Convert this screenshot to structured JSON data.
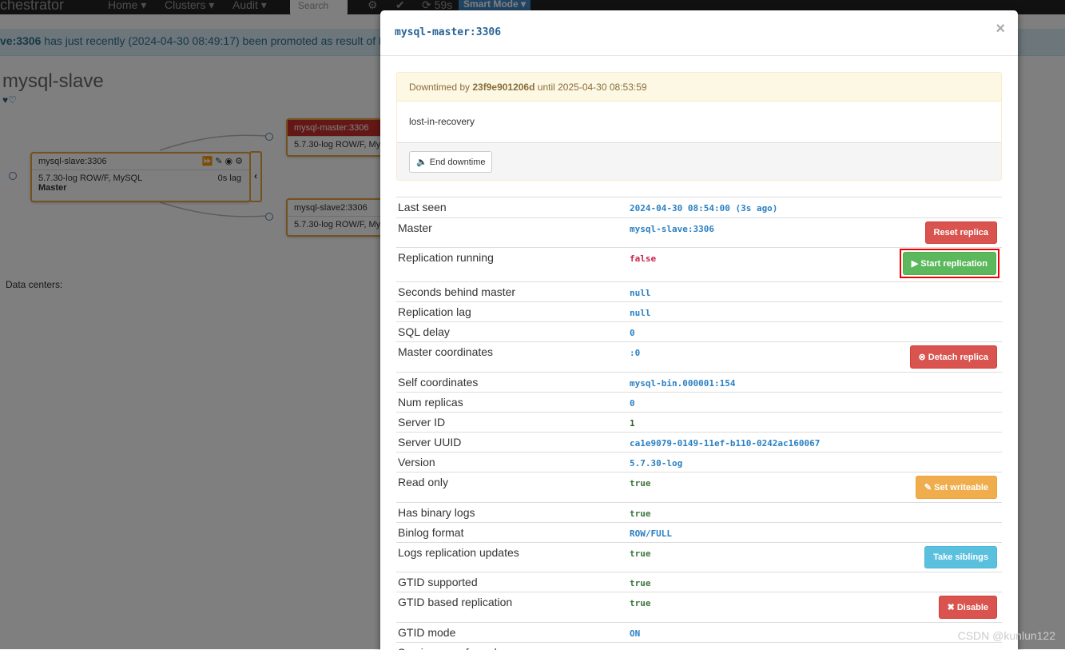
{
  "navbar": {
    "brand": "chestrator",
    "menus": [
      "Home",
      "Clusters",
      "Audit"
    ],
    "search_placeholder": "Search",
    "timer": "59s",
    "smart_mode": "Smart Mode"
  },
  "banner": {
    "instance": "ve:3306",
    "message": " has just recently (2024-04-30 08:49:17) been promoted as result of ",
    "tail": "D"
  },
  "cluster": {
    "title": "mysql-slave",
    "hearts": "♥♡",
    "nodes": [
      {
        "name": "mysql-slave:3306",
        "version": "5.7.30-log ROW/F, MySQL",
        "lag": "0s lag",
        "role": "Master"
      },
      {
        "name": "mysql-master:3306",
        "version": "5.7.30-log ROW/F, My"
      },
      {
        "name": "mysql-slave2:3306",
        "version": "5.7.30-log ROW/F, My"
      }
    ],
    "data_centers_label": "Data centers:"
  },
  "modal": {
    "title": "mysql-master:3306",
    "close": "×",
    "downtime": {
      "prefix": "Downtimed by ",
      "owner": "23f9e901206d",
      "until": " until 2025-04-30 08:53:59",
      "reason": "lost-in-recovery",
      "end_button": "End downtime"
    },
    "rows": [
      {
        "key": "Last seen",
        "value": "2024-04-30 08:54:00 (3s ago)",
        "color": "#2a80c4"
      },
      {
        "key": "Master",
        "value": "mysql-slave:3306",
        "color": "#2a80c4",
        "button": "Reset replica",
        "btn_style": "red"
      },
      {
        "key": "Replication running",
        "value": "false",
        "color": "#c7254e",
        "button": "▶ Start replication",
        "btn_style": "green",
        "highlight": true
      },
      {
        "key": "Seconds behind master",
        "value": "null",
        "color": "#2a80c4"
      },
      {
        "key": "Replication lag",
        "value": "null",
        "color": "#2a80c4"
      },
      {
        "key": "SQL delay",
        "value": "0",
        "color": "#2a80c4"
      },
      {
        "key": "Master coordinates",
        "value": ":0",
        "color": "#2a80c4",
        "button": "⊗ Detach replica",
        "btn_style": "red"
      },
      {
        "key": "Self coordinates",
        "value": "mysql-bin.000001:154",
        "color": "#2a80c4"
      },
      {
        "key": "Num replicas",
        "value": "0",
        "color": "#2a80c4"
      },
      {
        "key": "Server ID",
        "value": "1",
        "color": "#2f5f2f"
      },
      {
        "key": "Server UUID",
        "value": "ca1e9079-0149-11ef-b110-0242ac160067",
        "color": "#2a80c4"
      },
      {
        "key": "Version",
        "value": "5.7.30-log",
        "color": "#2a80c4"
      },
      {
        "key": "Read only",
        "value": "true",
        "color": "#3c763d",
        "button": "✎ Set writeable",
        "btn_style": "orange"
      },
      {
        "key": "Has binary logs",
        "value": "true",
        "color": "#3c763d"
      },
      {
        "key": "Binlog format",
        "value": "ROW/FULL",
        "color": "#2a80c4"
      },
      {
        "key": "Logs replication updates",
        "value": "true",
        "color": "#3c763d",
        "button": "Take siblings",
        "btn_style": "cyan"
      },
      {
        "key": "GTID supported",
        "value": "true",
        "color": "#3c763d"
      },
      {
        "key": "GTID based replication",
        "value": "true",
        "color": "#3c763d",
        "button": "✖ Disable",
        "btn_style": "red"
      },
      {
        "key": "GTID mode",
        "value": "ON",
        "color": "#2a80c4"
      },
      {
        "key": "Semi-sync enforced",
        "value": "false",
        "color": "#c7254e"
      }
    ]
  },
  "watermark": "CSDN @kunlun122"
}
